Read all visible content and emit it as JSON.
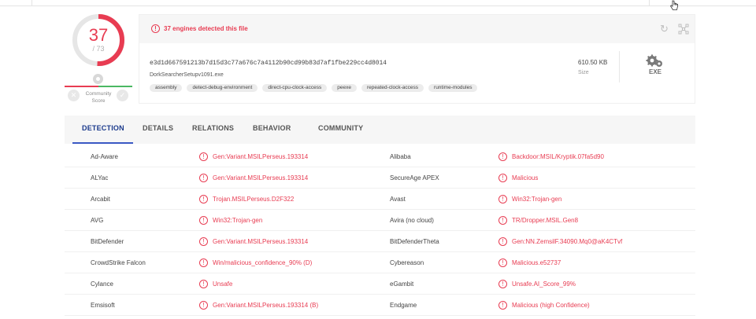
{
  "score": {
    "detected": "37",
    "total": "/ 73",
    "ratio": 0.507,
    "community_label": "Community Score"
  },
  "banner": {
    "text": "37 engines detected this file"
  },
  "file": {
    "hash": "e3d1d667591213b7d15d3c77a676c7a4112b90cd99b83d7af1fbe229cc4d8014",
    "name": "DorkSearcherSetupv1091.exe",
    "tags": [
      "assembly",
      "detect-debug-environment",
      "direct-cpu-clock-access",
      "peexe",
      "repeated-clock-access",
      "runtime-modules"
    ],
    "size": "610.50 KB",
    "size_label": "Size",
    "type": "EXE"
  },
  "tabs": [
    "DETECTION",
    "DETAILS",
    "RELATIONS",
    "BEHAVIOR",
    "COMMUNITY"
  ],
  "detections": [
    {
      "engine": "Ad-Aware",
      "result": "Gen:Variant.MSILPerseus.193314",
      "engine2": "Alibaba",
      "result2": "Backdoor:MSIL/Kryptik.07fa5d90"
    },
    {
      "engine": "ALYac",
      "result": "Gen:Variant.MSILPerseus.193314",
      "engine2": "SecureAge APEX",
      "result2": "Malicious"
    },
    {
      "engine": "Arcabit",
      "result": "Trojan.MSILPerseus.D2F322",
      "engine2": "Avast",
      "result2": "Win32:Trojan-gen"
    },
    {
      "engine": "AVG",
      "result": "Win32:Trojan-gen",
      "engine2": "Avira (no cloud)",
      "result2": "TR/Dropper.MSIL.Gen8"
    },
    {
      "engine": "BitDefender",
      "result": "Gen:Variant.MSILPerseus.193314",
      "engine2": "BitDefenderTheta",
      "result2": "Gen:NN.ZemsilF.34090.Mq0@aK4CTvf"
    },
    {
      "engine": "CrowdStrike Falcon",
      "result": "Win/malicious_confidence_90% (D)",
      "engine2": "Cybereason",
      "result2": "Malicious.e52737"
    },
    {
      "engine": "Cylance",
      "result": "Unsafe",
      "engine2": "eGambit",
      "result2": "Unsafe.AI_Score_99%"
    },
    {
      "engine": "Emsisoft",
      "result": "Gen:Variant.MSILPerseus.193314 (B)",
      "engine2": "Endgame",
      "result2": "Malicious (high Confidence)"
    }
  ],
  "colors": {
    "malicious": "#e83c52",
    "clean": "#4bb862",
    "tab_active": "#3a58c4"
  }
}
